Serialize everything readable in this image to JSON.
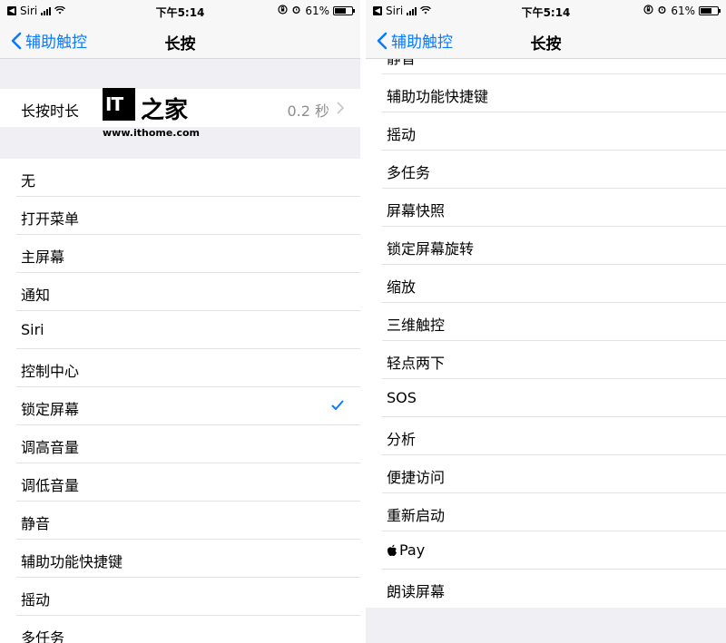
{
  "status": {
    "back_app": "Siri",
    "time": "下午5:14",
    "battery": "61%"
  },
  "nav": {
    "back_label": "辅助触控",
    "title": "长按"
  },
  "left": {
    "duration_row": {
      "label": "长按时长",
      "value": "0.2 秒"
    },
    "actions": [
      {
        "label": "无"
      },
      {
        "label": "打开菜单"
      },
      {
        "label": "主屏幕"
      },
      {
        "label": "通知"
      },
      {
        "label": "Siri"
      },
      {
        "label": "控制中心"
      },
      {
        "label": "锁定屏幕",
        "checked": true
      },
      {
        "label": "调高音量"
      },
      {
        "label": "调低音量"
      },
      {
        "label": "静音"
      },
      {
        "label": "辅助功能快捷键"
      },
      {
        "label": "摇动"
      },
      {
        "label": "多任务"
      }
    ]
  },
  "right": {
    "actions": [
      {
        "label": "静音"
      },
      {
        "label": "辅助功能快捷键"
      },
      {
        "label": "摇动"
      },
      {
        "label": "多任务"
      },
      {
        "label": "屏幕快照"
      },
      {
        "label": "锁定屏幕旋转"
      },
      {
        "label": "缩放"
      },
      {
        "label": "三维触控"
      },
      {
        "label": "轻点两下"
      },
      {
        "label": "SOS"
      },
      {
        "label": "分析"
      },
      {
        "label": "便捷访问"
      },
      {
        "label": "重新启动"
      },
      {
        "label": "Pay",
        "apple_logo": true
      },
      {
        "label": "朗读屏幕"
      }
    ]
  },
  "watermark": {
    "logo_text": "IT",
    "chars": "之家",
    "url": "www.ithome.com"
  },
  "colors": {
    "accent": "#0a7aff",
    "background": "#efeff4",
    "separator": "#e3e3e6",
    "secondary_text": "#8e8e93"
  }
}
